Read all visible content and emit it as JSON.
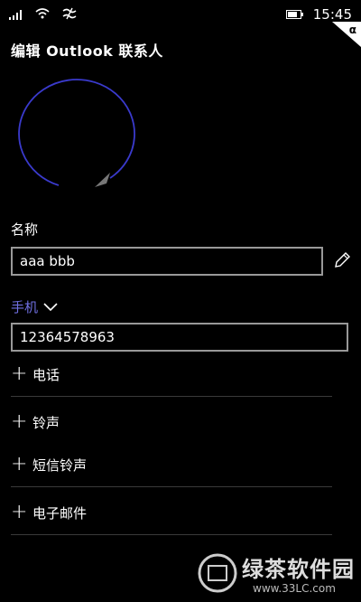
{
  "status_bar": {
    "time": "15:45",
    "icons": [
      "signal-bars-icon",
      "wifi-icon",
      "data-icon",
      "battery-icon"
    ]
  },
  "corner_label": "α",
  "title": "编辑 Outlook 联系人",
  "name_section": {
    "label": "名称",
    "value": "aaa bbb"
  },
  "phone_section": {
    "type_label": "手机",
    "value": "12364578963"
  },
  "add_items": [
    {
      "label": "电话"
    },
    {
      "label": "铃声"
    },
    {
      "label": "短信铃声"
    },
    {
      "label": "电子邮件"
    }
  ],
  "watermark": {
    "brand": "绿茶软件园",
    "url": "www.33LC.com"
  },
  "colors": {
    "accent": "#6f6fe0",
    "background": "#000000",
    "text": "#ffffff"
  }
}
